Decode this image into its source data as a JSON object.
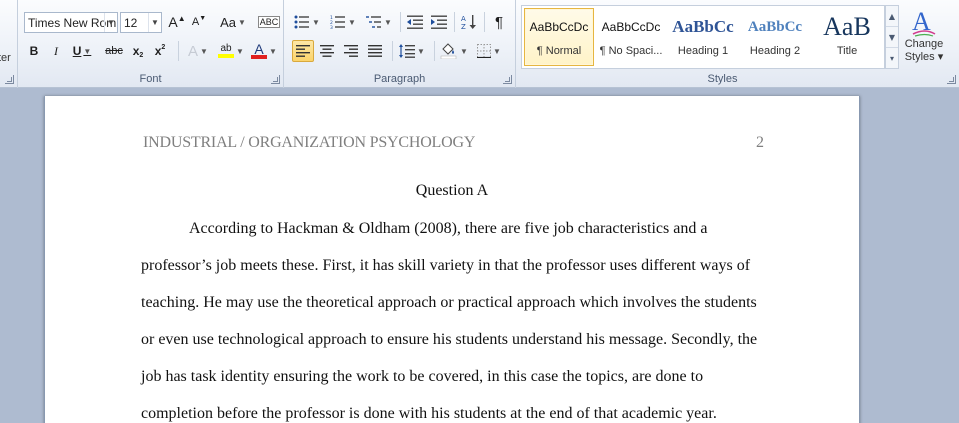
{
  "ribbon": {
    "clipboard_label_fragment": "ter",
    "font": {
      "label": "Font",
      "font_name": "Times New Rom",
      "font_size": "12",
      "grow": "A",
      "shrink": "A",
      "change_case": "Aa",
      "bold": "B",
      "italic": "I",
      "underline": "U",
      "strikethrough": "abc",
      "subscript": "x",
      "superscript": "x",
      "text_effects": "A",
      "highlight": "ab",
      "font_color": "A"
    },
    "paragraph": {
      "label": "Paragraph",
      "show_marks": "¶"
    },
    "styles": {
      "label": "Styles",
      "items": [
        {
          "sample": "AaBbCcDc",
          "name": "¶ Normal"
        },
        {
          "sample": "AaBbCcDc",
          "name": "¶ No Spaci..."
        },
        {
          "sample": "AaBbCc",
          "name": "Heading 1"
        },
        {
          "sample": "AaBbCc",
          "name": "Heading 2"
        },
        {
          "sample": "AaB",
          "name": "Title"
        }
      ],
      "change_styles_line1": "Change",
      "change_styles_line2": "Styles ▾"
    }
  },
  "document": {
    "header": "INDUSTRIAL / ORGANIZATION PSYCHOLOGY",
    "page_number": "2",
    "title": "Question A",
    "lines": [
      "According to Hackman & Oldham (2008), there are five job characteristics and a",
      "professor’s job meets these. First, it has skill variety in that the professor uses different ways of",
      "teaching. He may use the theoretical approach or practical approach which involves the students",
      "or even use technological approach to ensure his students understand his message. Secondly, the",
      "job has task identity ensuring the work to be covered, in this case the topics, are done to",
      "completion before the professor is done with his students at the end of that academic year."
    ]
  },
  "colors": {
    "accent_blue": "#1f4e9c",
    "font_color_red": "#e02020",
    "highlight_yellow": "#ffff00",
    "doc_background": "#aebbd0"
  }
}
